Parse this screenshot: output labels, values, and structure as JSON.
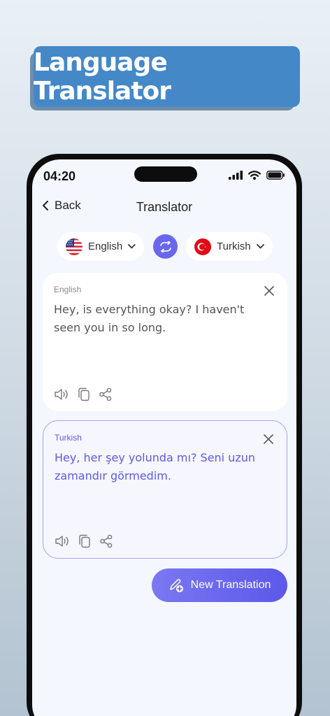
{
  "banner": {
    "title": "Language Translator"
  },
  "status": {
    "time": "04:20"
  },
  "nav": {
    "back_label": "Back",
    "title": "Translator"
  },
  "languages": {
    "source": "English",
    "target": "Turkish"
  },
  "source_card": {
    "lang_label": "English",
    "text": "Hey, is everything okay? I haven't seen you in so long."
  },
  "target_card": {
    "lang_label": "Turkish",
    "text": "Hey, her şey yolunda mı? Seni uzun zamandır görmedim."
  },
  "actions": {
    "new_translation_label": "New Translation"
  },
  "colors": {
    "accent": "#6a67ee",
    "banner": "#4588c8",
    "translation_text": "#5d5ae6"
  },
  "icons": [
    "chevron-left-icon",
    "swap-icon",
    "chevron-down-icon",
    "close-icon",
    "speaker-icon",
    "copy-icon",
    "share-icon",
    "pencil-plus-icon",
    "signal-icon",
    "wifi-icon",
    "battery-icon"
  ]
}
